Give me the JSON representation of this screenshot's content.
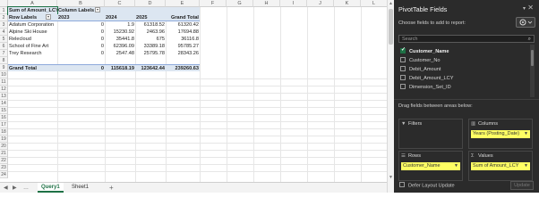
{
  "sheet": {
    "columns": [
      "A",
      "B",
      "C",
      "D",
      "E",
      "F",
      "G",
      "H",
      "I",
      "J",
      "K",
      "L"
    ],
    "rows": [
      "1",
      "2",
      "3",
      "4",
      "5",
      "6",
      "7",
      "8",
      "9",
      "10",
      "11",
      "12",
      "13",
      "14",
      "15",
      "16",
      "17",
      "18",
      "19",
      "20",
      "21",
      "22",
      "23",
      "24"
    ]
  },
  "pivot": {
    "values_header": "Sum of Amount_LCY",
    "columns_header": "Column Labels",
    "row_labels_header": "Row Labels",
    "year_headers": [
      "2023",
      "2024",
      "2025"
    ],
    "grand_total_header": "Grand Total",
    "rows": [
      {
        "label": "Adatum Corporation",
        "v2023": "0",
        "v2024": "1.9",
        "v2025": "61318.52",
        "total": "61320.42"
      },
      {
        "label": "Alpine Ski House",
        "v2023": "0",
        "v2024": "15230.92",
        "v2025": "2463.96",
        "total": "17694.88"
      },
      {
        "label": "Relecloud",
        "v2023": "0",
        "v2024": "35441.8",
        "v2025": "675",
        "total": "36116.8"
      },
      {
        "label": "School of Fine Art",
        "v2023": "0",
        "v2024": "62396.09",
        "v2025": "33389.18",
        "total": "95785.27"
      },
      {
        "label": "Trey Research",
        "v2023": "0",
        "v2024": "2547.48",
        "v2025": "25795.78",
        "total": "28343.26"
      }
    ],
    "grand_total": {
      "label": "Grand Total",
      "v2023": "0",
      "v2024": "115618.19",
      "v2025": "123642.44",
      "total": "239260.63"
    }
  },
  "tabs": {
    "items": [
      "Query1",
      "Sheet1"
    ],
    "active": "Query1",
    "add": "+"
  },
  "pane": {
    "title": "PivotTable Fields",
    "subtitle": "Choose fields to add to report:",
    "search_placeholder": "Search",
    "fields": [
      {
        "name": "Customer_Name",
        "checked": true
      },
      {
        "name": "Customer_No",
        "checked": false
      },
      {
        "name": "Debit_Amount",
        "checked": false
      },
      {
        "name": "Debit_Amount_LCY",
        "checked": false
      },
      {
        "name": "Dimension_Set_ID",
        "checked": false
      }
    ],
    "drag_label": "Drag fields between areas below:",
    "filters_label": "Filters",
    "columns_label": "Columns",
    "rows_label": "Rows",
    "values_label": "Values",
    "columns_field": "Years (Posting_Date)",
    "rows_field": "Customer_Name",
    "values_field": "Sum of Amount_LCY",
    "defer_label": "Defer Layout Update",
    "update_label": "Update"
  },
  "colors": {
    "accent": "#1e7145",
    "pill": "#ffff63",
    "pane_bg": "#2b2b2b",
    "pivot_header": "#dce6f1"
  }
}
